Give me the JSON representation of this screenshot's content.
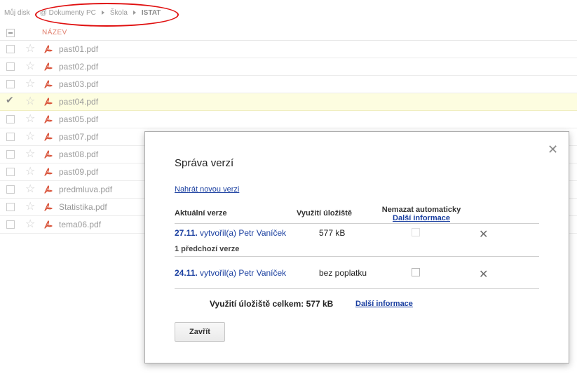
{
  "breadcrumb": {
    "root": "Můj disk",
    "items": [
      "@ Dokumenty PC",
      "Škola",
      "ISTAT"
    ]
  },
  "list": {
    "header_name": "NÁZEV",
    "files": [
      {
        "name": "past01.pdf",
        "selected": false
      },
      {
        "name": "past02.pdf",
        "selected": false
      },
      {
        "name": "past03.pdf",
        "selected": false
      },
      {
        "name": "past04.pdf",
        "selected": true
      },
      {
        "name": "past05.pdf",
        "selected": false
      },
      {
        "name": "past07.pdf",
        "selected": false
      },
      {
        "name": "past08.pdf",
        "selected": false
      },
      {
        "name": "past09.pdf",
        "selected": false
      },
      {
        "name": "predmluva.pdf",
        "selected": false
      },
      {
        "name": "Statistika.pdf",
        "selected": false
      },
      {
        "name": "tema06.pdf",
        "selected": false
      }
    ]
  },
  "modal": {
    "title": "Správa verzí",
    "close_icon": "close-icon",
    "upload_link": "Nahrát novou verzi",
    "col_current": "Aktuální verze",
    "col_usage": "Využití úložiště",
    "col_keep": "Nemazat automaticky",
    "col_keep_link": "Další informace",
    "current": {
      "date": "27.11.",
      "author": " vytvořil(a) Petr Vaníček",
      "usage": "577 kB"
    },
    "previous_count": "1",
    "previous_label": " předchozí verze",
    "previous": {
      "date": "24.11.",
      "author": " vytvořil(a) Petr Vaníček",
      "usage": "bez poplatku"
    },
    "total_label": "Využití úložiště celkem: 577 kB",
    "total_link": "Další informace",
    "close_button": "Zavřít"
  },
  "colors": {
    "link": "#1a3fa0",
    "header_name": "#e07e6c",
    "selected_row": "#fdfde0",
    "pdf_icon": "#d9533a",
    "annotation_circle": "#e01010"
  }
}
